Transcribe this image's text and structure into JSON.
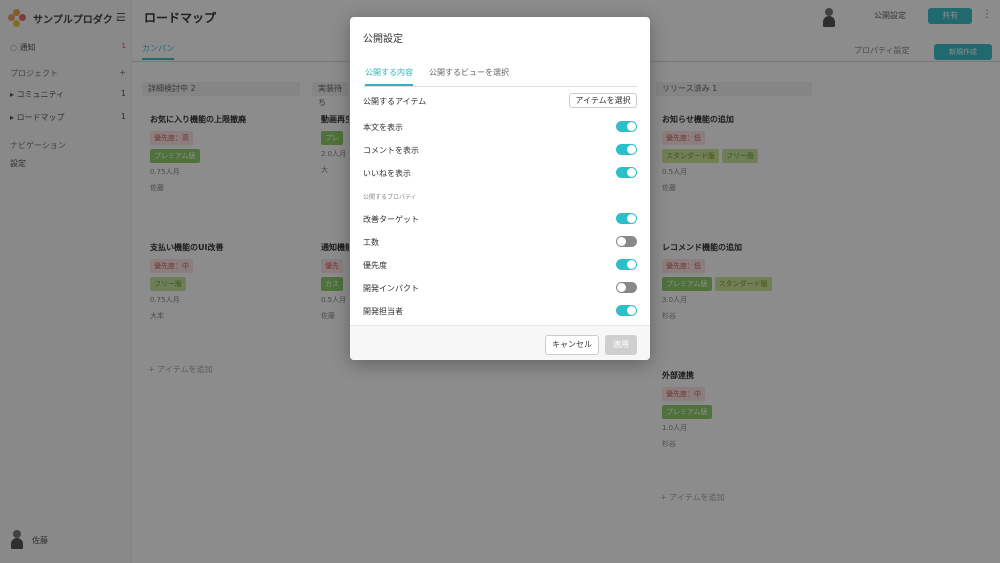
{
  "app": {
    "product_name": "サンプルプロダク",
    "page_title": "ロードマップ",
    "publish_settings_label": "公開設定",
    "share_label": "共有",
    "tab_kanban": "カンバン",
    "property_settings_label": "プロパティ設定",
    "new_item_label": "新規作成"
  },
  "sidebar": {
    "notifications": {
      "label": "通知",
      "badge": "1"
    },
    "projects_label": "プロジェクト",
    "items": [
      {
        "label": "コミュニティ",
        "count": "1"
      },
      {
        "label": "ロードマップ",
        "count": "1"
      }
    ],
    "navigation_label": "ナビゲーション",
    "settings_label": "設定",
    "user_name": "佐藤"
  },
  "board": {
    "columns": [
      {
        "title": "詳細検討中",
        "count": "2"
      },
      {
        "title": "実装待ち"
      },
      {
        "title": "リリース済み",
        "count": "1"
      }
    ],
    "cards": [
      {
        "title": "お気に入り機能の上限撤廃",
        "tags": [
          "優先度：高",
          "プレミアム版"
        ],
        "effort": "0.75人月",
        "assignee": "佐藤"
      },
      {
        "title": "支払い機能のUI改善",
        "tags": [
          "優先度：中",
          "フリー版"
        ],
        "effort": "0.75人月",
        "assignee": "大本"
      },
      {
        "title": "動画再生",
        "tags": [
          "プレ"
        ],
        "effort": "2.0人月",
        "assignee": "大"
      },
      {
        "title": "通知機能",
        "tags": [
          "優先",
          "カス"
        ],
        "effort": "0.5人月",
        "assignee": "佐藤"
      },
      {
        "title": "お知らせ機能の追加",
        "tags": [
          "優先度：低",
          "スタンダード版",
          "フリー版"
        ],
        "effort": "0.5人月",
        "assignee": "佐藤"
      },
      {
        "title": "レコメンド機能の追加",
        "tags": [
          "優先度：低",
          "プレミアム版",
          "スタンダード版"
        ],
        "effort": "3.0人月",
        "assignee": "杉谷"
      },
      {
        "title": "外部連携",
        "tags": [
          "優先度：中",
          "プレミアム版"
        ],
        "effort": "1.0人月",
        "assignee": "杉谷"
      }
    ],
    "add_item_label": "アイテムを追加"
  },
  "modal": {
    "title": "公開設定",
    "tabs": [
      "公開する内容",
      "公開するビューを選択"
    ],
    "items_label": "公開するアイテム",
    "select_items_button": "アイテムを選択",
    "toggles": [
      {
        "label": "本文を表示",
        "on": true
      },
      {
        "label": "コメントを表示",
        "on": true
      },
      {
        "label": "いいねを表示",
        "on": true
      }
    ],
    "properties_section_label": "公開するプロパティ",
    "property_toggles": [
      {
        "label": "改善ターゲット",
        "on": true
      },
      {
        "label": "工数",
        "on": false
      },
      {
        "label": "優先度",
        "on": true
      },
      {
        "label": "開発インパクト",
        "on": false
      },
      {
        "label": "開発担当者",
        "on": true
      }
    ],
    "cancel_label": "キャンセル",
    "apply_label": "適用"
  },
  "colors": {
    "accent": "#2bbfca",
    "overlay": "rgba(0,0,0,0.45)"
  }
}
